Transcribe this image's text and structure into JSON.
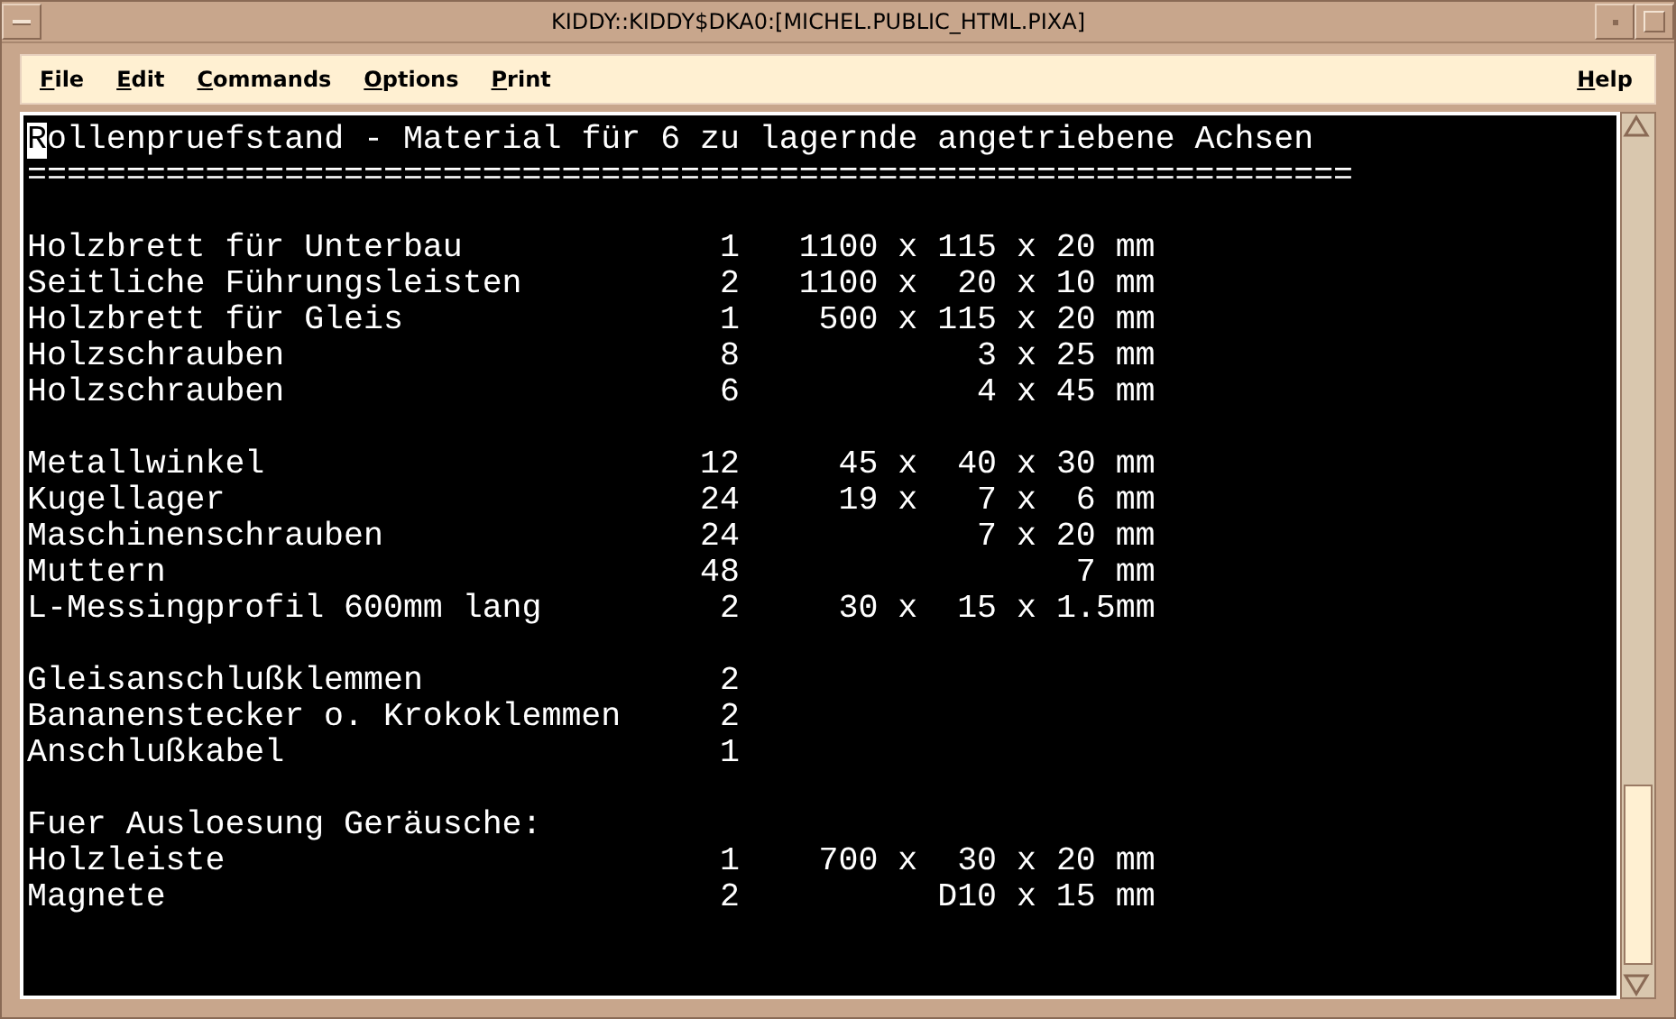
{
  "window": {
    "title": "KIDDY::KIDDY$DKA0:[MICHEL.PUBLIC_HTML.PIXA]"
  },
  "menu": {
    "items": [
      "File",
      "Edit",
      "Commands",
      "Options",
      "Print"
    ],
    "help": "Help"
  },
  "terminal": {
    "lines": [
      {
        "kind": "text",
        "text": "Rollenpruefstand - Material für 6 zu lagernde angetriebene Achsen",
        "cursor": true
      },
      {
        "kind": "text",
        "text": "===================================================================",
        "cursor": false
      },
      {
        "kind": "blank"
      },
      {
        "kind": "item",
        "item": "Holzbrett für Unterbau",
        "qty": "1",
        "size": "1100 x 115 x 20 mm"
      },
      {
        "kind": "item",
        "item": "Seitliche Führungsleisten",
        "qty": "2",
        "size": "1100 x  20 x 10 mm"
      },
      {
        "kind": "item",
        "item": "Holzbrett für Gleis",
        "qty": "1",
        "size": "500 x 115 x 20 mm"
      },
      {
        "kind": "item",
        "item": "Holzschrauben",
        "qty": "8",
        "size": "3 x 25 mm"
      },
      {
        "kind": "item",
        "item": "Holzschrauben",
        "qty": "6",
        "size": "4 x 45 mm"
      },
      {
        "kind": "blank"
      },
      {
        "kind": "item",
        "item": "Metallwinkel",
        "qty": "12",
        "size": "45 x  40 x 30 mm"
      },
      {
        "kind": "item",
        "item": "Kugellager",
        "qty": "24",
        "size": "19 x   7 x  6 mm"
      },
      {
        "kind": "item",
        "item": "Maschinenschrauben",
        "qty": "24",
        "size": "7 x 20 mm"
      },
      {
        "kind": "item",
        "item": "Muttern",
        "qty": "48",
        "size": "7 mm"
      },
      {
        "kind": "item",
        "item": "L-Messingprofil 600mm lang",
        "qty": "2",
        "size": "30 x  15 x 1.5mm"
      },
      {
        "kind": "blank"
      },
      {
        "kind": "item",
        "item": "Gleisanschlußklemmen",
        "qty": "2"
      },
      {
        "kind": "item",
        "item": "Bananenstecker o. Krokoklemmen",
        "qty": "2"
      },
      {
        "kind": "item",
        "item": "Anschlußkabel",
        "qty": "1"
      },
      {
        "kind": "blank"
      },
      {
        "kind": "text",
        "text": "Fuer Ausloesung Geräusche:",
        "cursor": false
      },
      {
        "kind": "item",
        "item": "Holzleiste",
        "qty": "1",
        "size": "700 x  30 x 20 mm"
      },
      {
        "kind": "item",
        "item": "Magnete",
        "qty": "2",
        "size": "D10 x 15 mm"
      }
    ]
  }
}
